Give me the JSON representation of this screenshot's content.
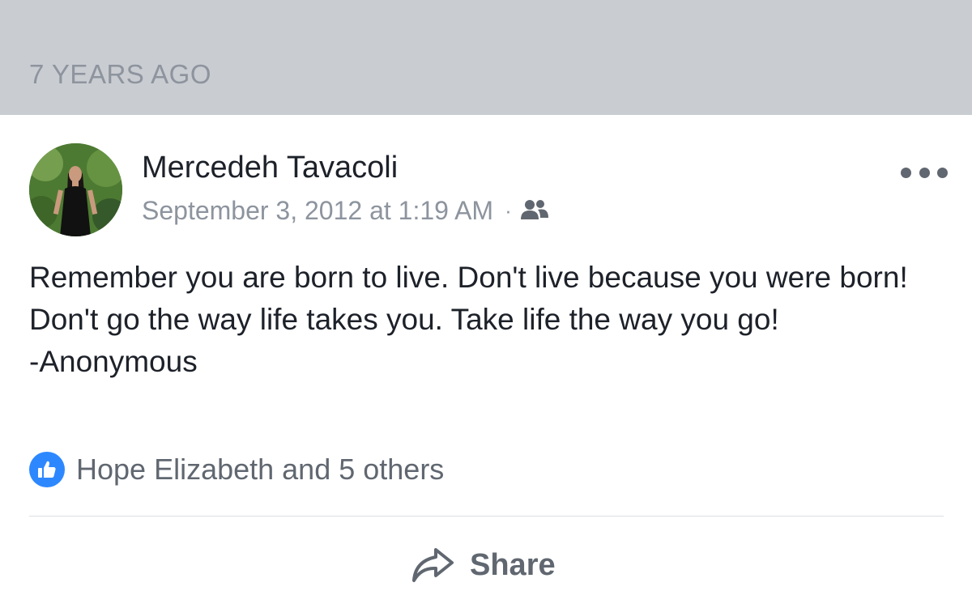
{
  "memory": {
    "label": "7 YEARS AGO"
  },
  "post": {
    "author": "Mercedeh Tavacoli",
    "timestamp": "September 3, 2012 at 1:19 AM",
    "separator": "·",
    "audience_icon": "friends-icon",
    "more_icon": "more-options-icon",
    "text": "Remember you are born to live. Don't live because you were born! Don't go the way life takes you. Take life the way you go!\n-Anonymous",
    "reactions": {
      "icon": "like-icon",
      "text": "Hope Elizabeth and 5 others"
    },
    "actions": {
      "share_label": "Share",
      "share_icon": "share-arrow-icon"
    }
  },
  "colors": {
    "header_bg": "#c9ccd1",
    "muted_text": "#8d949e",
    "primary_text": "#1d2129",
    "secondary_text": "#606770",
    "like_blue": "#2d88ff"
  }
}
